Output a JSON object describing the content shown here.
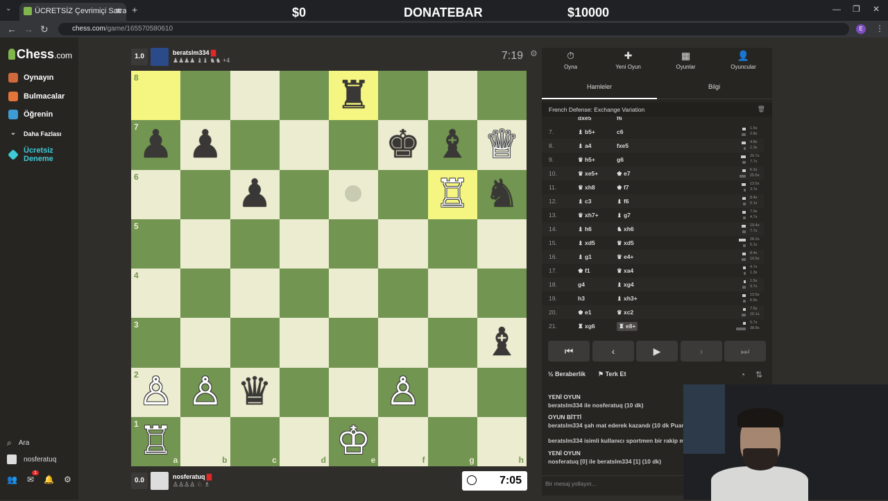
{
  "browser": {
    "tab_title": "ÜCRETSİZ Çevrimiçi Satranç Oyna",
    "url_host": "chess.com",
    "url_path": "/game/165570580610",
    "donatebar": {
      "left": "$0",
      "center": "DONATEBAR",
      "right": "$10000"
    }
  },
  "nav": {
    "logo_main": "Chess",
    "logo_suffix": ".com",
    "items": [
      {
        "label": "Oynayın",
        "color": "#d06a3d"
      },
      {
        "label": "Bulmacalar",
        "color": "#e3753a"
      },
      {
        "label": "Öğrenin",
        "color": "#3d9bd6"
      },
      {
        "label": "Daha Fazlası",
        "color": ""
      },
      {
        "label": "Ücretsiz Deneme",
        "color": "#3ecbd8"
      }
    ],
    "search": "Ara",
    "user": "nosferatuq",
    "notif_badge": "1"
  },
  "top_player": {
    "score": "1.0",
    "name": "beratslm334",
    "captured": "♟♟♟♟ ♝♝ ♞♞ +4",
    "clock": "7:19"
  },
  "bottom_player": {
    "score": "0.0",
    "name": "nosferatuq",
    "captured": "♙♙♙♙ ♘ ♗",
    "clock": "7:05"
  },
  "board": {
    "files": [
      "a",
      "b",
      "c",
      "d",
      "e",
      "f",
      "g",
      "h"
    ],
    "ranks": [
      "8",
      "7",
      "6",
      "5",
      "4",
      "3",
      "2",
      "1"
    ],
    "highlights": [
      "a8",
      "e8",
      "g6"
    ],
    "pieces": [
      {
        "sq": "e8",
        "glyph": "♜",
        "color": "b",
        "name": "black-rook"
      },
      {
        "sq": "a7",
        "glyph": "♟",
        "color": "b",
        "name": "black-pawn"
      },
      {
        "sq": "b7",
        "glyph": "♟",
        "color": "b",
        "name": "black-pawn"
      },
      {
        "sq": "f7",
        "glyph": "♚",
        "color": "b",
        "name": "black-king"
      },
      {
        "sq": "g7",
        "glyph": "♝",
        "color": "b",
        "name": "black-bishop"
      },
      {
        "sq": "h7",
        "glyph": "♕",
        "color": "w",
        "name": "white-queen"
      },
      {
        "sq": "c6",
        "glyph": "♟",
        "color": "b",
        "name": "black-pawn"
      },
      {
        "sq": "g6",
        "glyph": "♖",
        "color": "w",
        "name": "white-rook"
      },
      {
        "sq": "h6",
        "glyph": "♞",
        "color": "b",
        "name": "black-knight"
      },
      {
        "sq": "h3",
        "glyph": "♝",
        "color": "b",
        "name": "black-bishop"
      },
      {
        "sq": "a2",
        "glyph": "♙",
        "color": "w",
        "name": "white-pawn"
      },
      {
        "sq": "b2",
        "glyph": "♙",
        "color": "w",
        "name": "white-pawn"
      },
      {
        "sq": "c2",
        "glyph": "♛",
        "color": "b",
        "name": "black-queen"
      },
      {
        "sq": "f2",
        "glyph": "♙",
        "color": "w",
        "name": "white-pawn"
      },
      {
        "sq": "a1",
        "glyph": "♖",
        "color": "w",
        "name": "white-rook"
      },
      {
        "sq": "e1",
        "glyph": "♔",
        "color": "w",
        "name": "white-king"
      }
    ]
  },
  "panel": {
    "tabs": [
      {
        "label": "Oyna",
        "icon": "⏱"
      },
      {
        "label": "Yeni Oyun",
        "icon": "✚"
      },
      {
        "label": "Oyunlar",
        "icon": "▦"
      },
      {
        "label": "Oyuncular",
        "icon": "👤"
      }
    ],
    "subtabs": [
      "Hamleler",
      "Bilgi"
    ],
    "opening": "French Defense: Exchange Variation",
    "partial_row": {
      "white": "dxe5",
      "black": "f6"
    },
    "moves": [
      {
        "n": "7.",
        "w": "♝ b5+",
        "b": "c6",
        "tw": "1.5s",
        "tb": "2.8s",
        "ww": 5,
        "wb": 6
      },
      {
        "n": "8.",
        "w": "♝ a4",
        "b": "fxe5",
        "tw": "4.8s",
        "tb": "1.3s",
        "ww": 6,
        "wb": 3
      },
      {
        "n": "9.",
        "w": "♛ h5+",
        "b": "g6",
        "tw": "20.7s",
        "tb": "7.7s",
        "ww": 7,
        "wb": 5
      },
      {
        "n": "10.",
        "w": "♛ xe5+",
        "b": "♚ e7",
        "tw": "6.2s",
        "tb": "25.5s",
        "ww": 5,
        "wb": 9
      },
      {
        "n": "11.",
        "w": "♛ xh8",
        "b": "♚ f7",
        "tw": "13.5s",
        "tb": "3.7s",
        "ww": 6,
        "wb": 3
      },
      {
        "n": "12.",
        "w": "♝ c3",
        "b": "♝ f6",
        "tw": "8.4s",
        "tb": "5.1s",
        "ww": 5,
        "wb": 4
      },
      {
        "n": "13.",
        "w": "♛ xh7+",
        "b": "♝ g7",
        "tw": "7.0s",
        "tb": "4.7s",
        "ww": 5,
        "wb": 4
      },
      {
        "n": "14.",
        "w": "♝ h6",
        "b": "♞ xh6",
        "tw": "19.4s",
        "tb": "7.7s",
        "ww": 6,
        "wb": 5
      },
      {
        "n": "15.",
        "w": "♝ xd5",
        "b": "♛ xd5",
        "tw": "28.2s",
        "tb": "5.1s",
        "ww": 10,
        "wb": 4
      },
      {
        "n": "16.",
        "w": "♝ g1",
        "b": "♛ e4+",
        "tw": "8.4s",
        "tb": "10.5s",
        "ww": 5,
        "wb": 6
      },
      {
        "n": "17.",
        "w": "♚ f1",
        "b": "♛ xa4",
        "tw": "4.7s",
        "tb": "1.3s",
        "ww": 4,
        "wb": 3
      },
      {
        "n": "18.",
        "w": "g4",
        "b": "♝ xg4",
        "tw": "1.5s",
        "tb": "9.7s",
        "ww": 3,
        "wb": 5
      },
      {
        "n": "19.",
        "w": "h3",
        "b": "♝ xh3+",
        "tw": "13.5s",
        "tb": "6.9s",
        "ww": 5,
        "wb": 4
      },
      {
        "n": "20.",
        "w": "♚ e1",
        "b": "♛ xc2",
        "tw": "7.5s",
        "tb": "10.1s",
        "ww": 4,
        "wb": 6
      },
      {
        "n": "21.",
        "w": "♜ xg6",
        "b": "♜ e8+",
        "tw": "5.7s",
        "tb": "38.8s",
        "ww": 4,
        "wb": 14
      }
    ],
    "nav_buttons": [
      "⏮",
      "‹",
      "▶",
      "›",
      "⏭"
    ],
    "draw": "Beraberlik",
    "draw_icon": "½",
    "resign": "Terk Et",
    "chat": [
      {
        "head": "YENİ OYUN",
        "line": "beratslm334 ile nosferatuq (10 dk)"
      },
      {
        "head": "OYUN BİTTİ",
        "line": "beratslm334 şah mat ederek kazandı (10 dk Puanl"
      },
      {
        "head": "",
        "line": "beratslm334 isimli kullanıcı sportmen bir rakip mi"
      },
      {
        "head": "YENİ OYUN",
        "line": "nosferatuq [0] ile beratslm334 [1] (10 dk)"
      }
    ],
    "chat_placeholder": "Bir mesaj yollayın..."
  }
}
